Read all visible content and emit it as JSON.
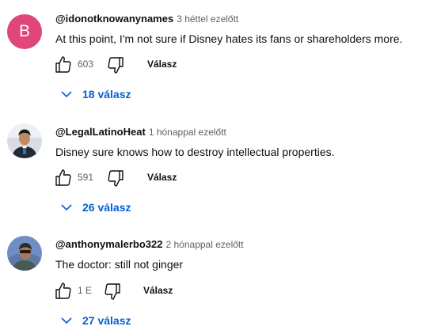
{
  "comments": [
    {
      "author": "@idonotknowanynames",
      "time": "3 héttel ezelőtt",
      "text": "At this point, I'm not sure if Disney hates its fans or shareholders more.",
      "avatar_letter": "B",
      "likes": "603",
      "reply_label": "Válasz",
      "replies_label": "18 válasz"
    },
    {
      "author": "@LegalLatinoHeat",
      "time": "1 hónappal ezelőtt",
      "text": "Disney sure knows how to destroy intellectual properties.",
      "likes": "591",
      "reply_label": "Válasz",
      "replies_label": "26 válasz"
    },
    {
      "author": "@anthonymalerbo322",
      "time": "2 hónappal ezelőtt",
      "text": "The doctor: still not ginger",
      "likes": "1 E",
      "reply_label": "Válasz",
      "replies_label": "27 válasz"
    }
  ],
  "colors": {
    "link_blue": "#065fd4",
    "avatar_pink": "#e0457b",
    "meta_gray": "#606060"
  },
  "icons": [
    "thumbs-up-icon",
    "thumbs-down-icon",
    "chevron-down-icon"
  ]
}
